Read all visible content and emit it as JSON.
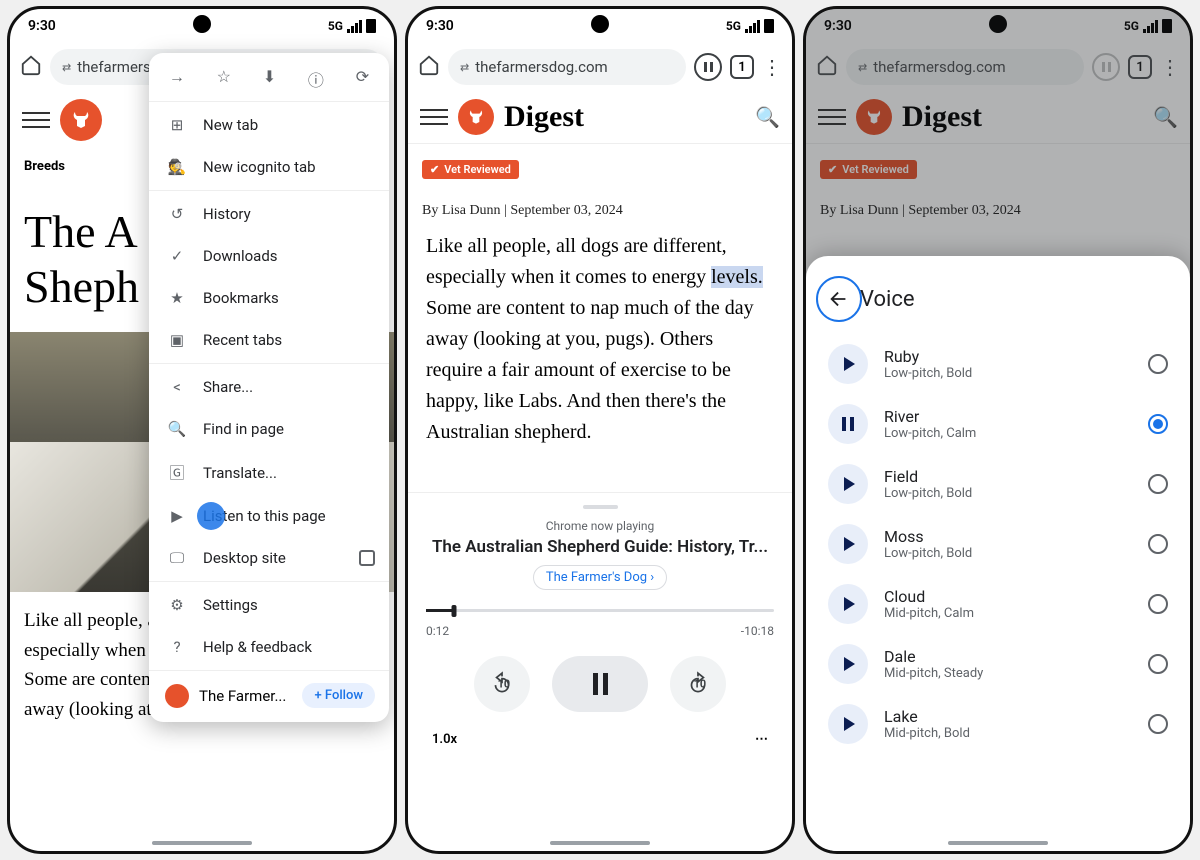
{
  "status": {
    "time": "9:30",
    "net": "5G"
  },
  "url": {
    "domain": "thefarmersdog.com",
    "tabs": "1"
  },
  "screen1": {
    "breeds": "Breeds",
    "title_line1": "The A",
    "title_line2": "Sheph",
    "para": "Like all people, all dogs are different, especially when it comes to energy levels. Some are content to nap much of the day away (looking at you, pugs).",
    "menu": {
      "new_tab": "New tab",
      "incog": "New icognito tab",
      "history": "History",
      "downloads": "Downloads",
      "bookmarks": "Bookmarks",
      "recent": "Recent tabs",
      "share": "Share...",
      "find": "Find in page",
      "translate": "Translate...",
      "listen": "Listen to this page",
      "desktop": "Desktop site",
      "settings": "Settings",
      "help": "Help & feedback",
      "account": "The Farmer...",
      "follow": "+  Follow"
    }
  },
  "screen2": {
    "brand": "Digest",
    "vet": "Vet Reviewed",
    "byline": "By Lisa Dunn  |  September 03, 2024",
    "para_pre": "Like all people, all dogs are different, especially when it comes to energy ",
    "para_hl": "levels.",
    "para_post": " Some are content to nap much of the day away (looking at you, pugs). Others require a fair amount of exercise to be happy, like Labs. And then there's the Australian shepherd.",
    "now_playing": "Chrome now playing",
    "track": "The Australian Shepherd Guide: History, Tr...",
    "source": "The Farmer's Dog  ›",
    "elapsed": "0:12",
    "remaining": "-10:18",
    "speed": "1.0x"
  },
  "screen3": {
    "brand": "Digest",
    "vet": "Vet Reviewed",
    "byline": "By Lisa Dunn  |  September 03, 2024",
    "voice_title": "Voice",
    "voices": [
      {
        "name": "Ruby",
        "desc": "Low-pitch, Bold",
        "selected": false,
        "playing": false
      },
      {
        "name": "River",
        "desc": "Low-pitch, Calm",
        "selected": true,
        "playing": true
      },
      {
        "name": "Field",
        "desc": "Low-pitch, Bold",
        "selected": false,
        "playing": false
      },
      {
        "name": "Moss",
        "desc": "Low-pitch, Bold",
        "selected": false,
        "playing": false
      },
      {
        "name": "Cloud",
        "desc": "Mid-pitch, Calm",
        "selected": false,
        "playing": false
      },
      {
        "name": "Dale",
        "desc": "Mid-pitch, Steady",
        "selected": false,
        "playing": false
      },
      {
        "name": "Lake",
        "desc": "Mid-pitch, Bold",
        "selected": false,
        "playing": false
      }
    ]
  }
}
